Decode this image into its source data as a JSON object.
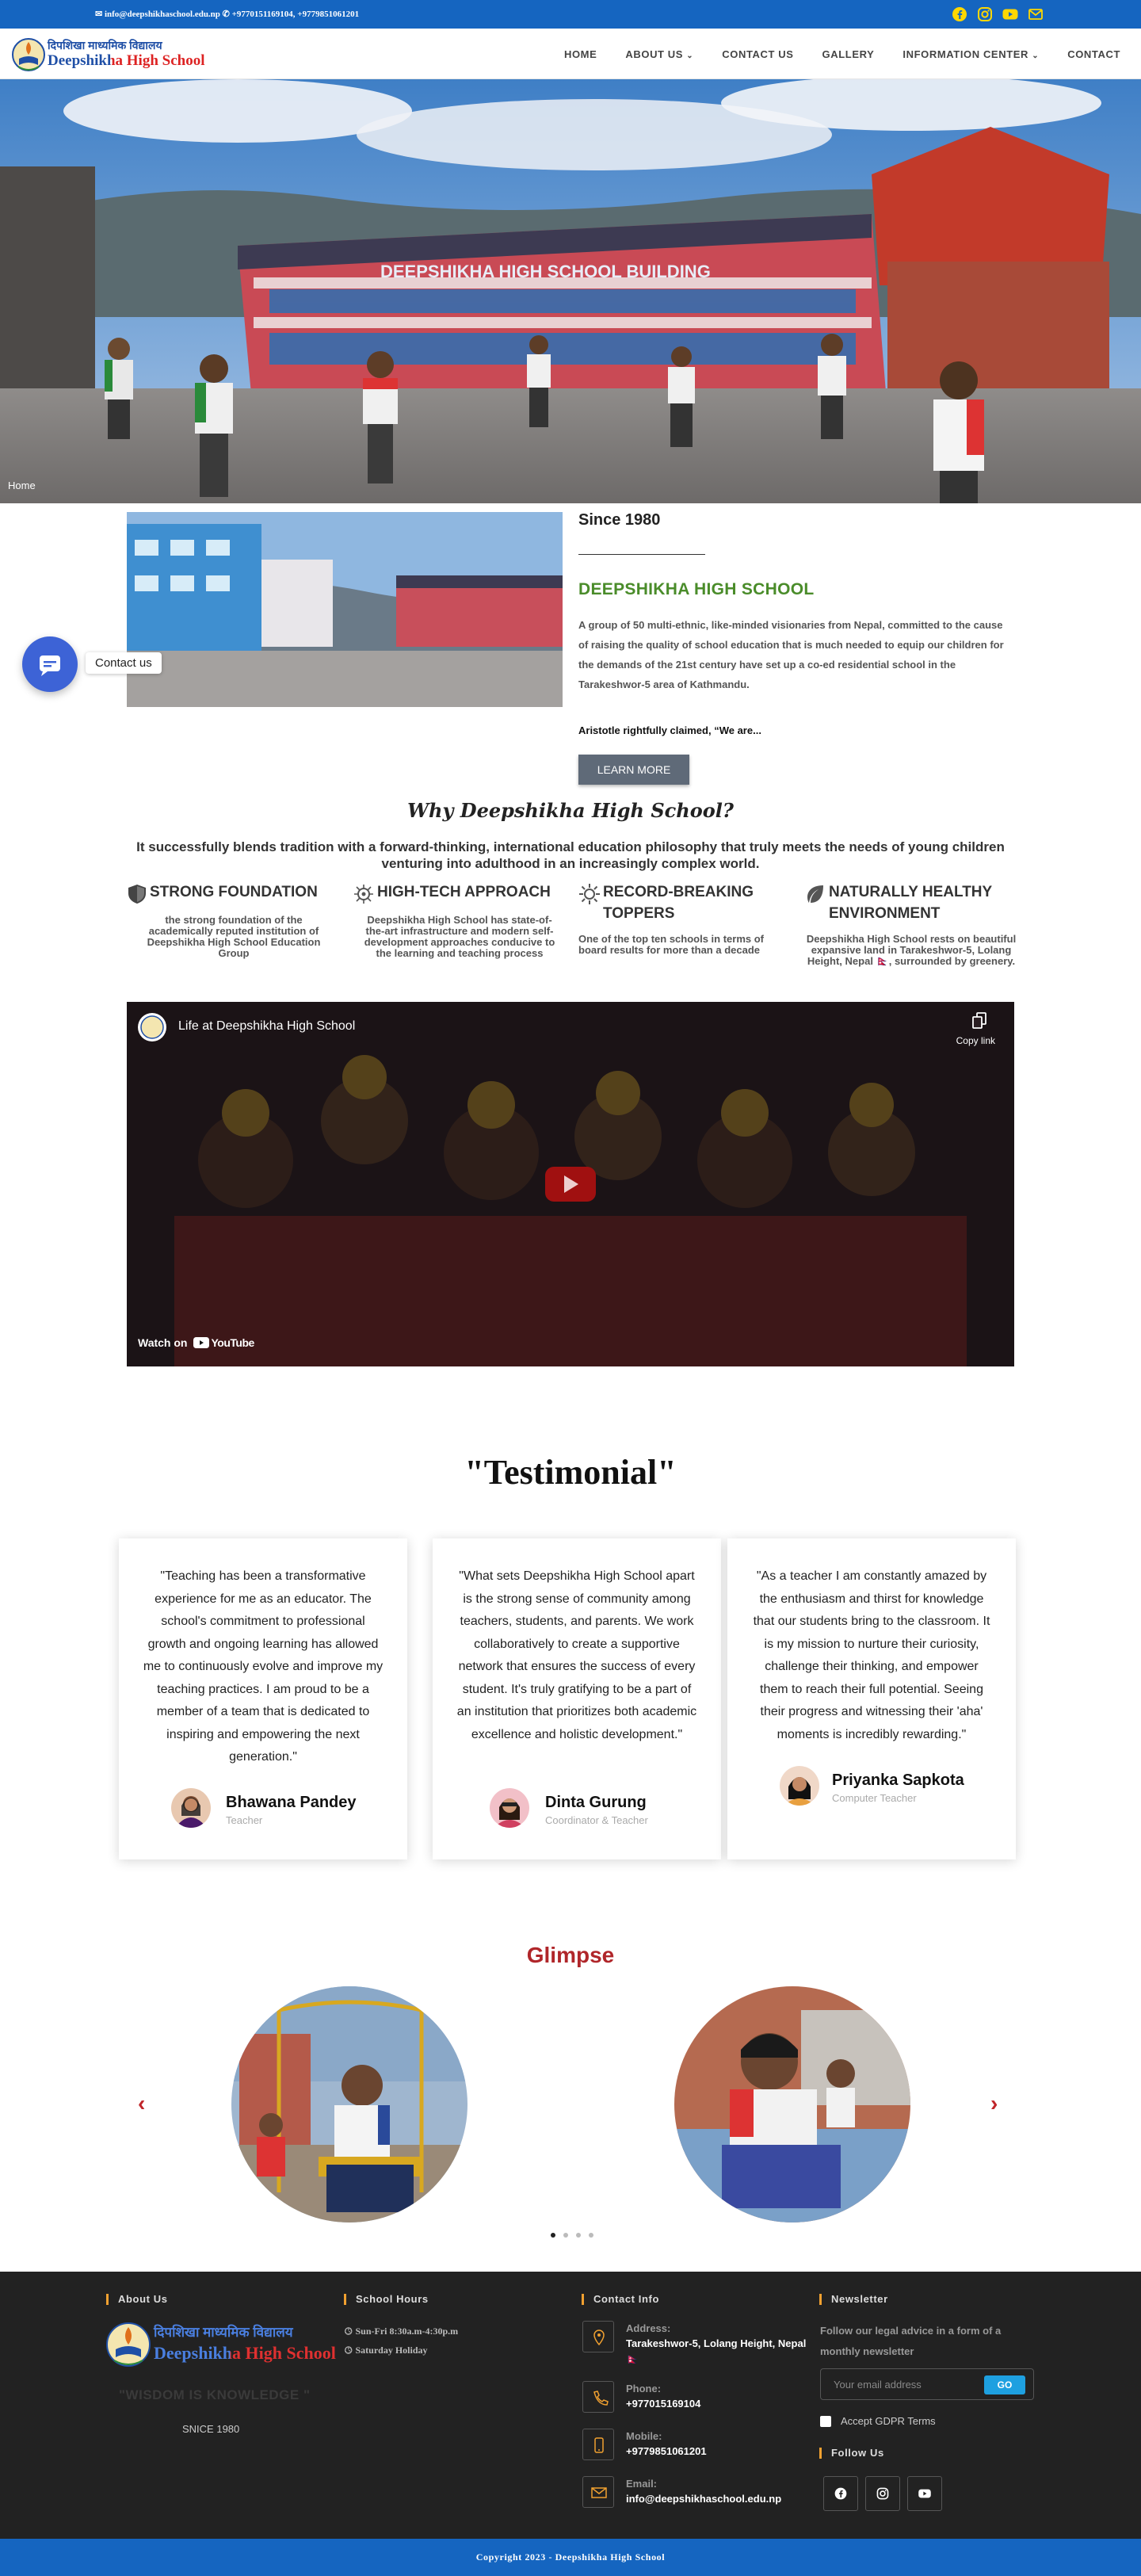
{
  "topbar": {
    "email": "info@deepshikhaschool.edu.np",
    "phones": "+9770151169104, +9779851061201",
    "social_icons": [
      "facebook-icon",
      "instagram-icon",
      "youtube-icon",
      "mail-icon"
    ],
    "icon_color": "#ffd700",
    "bg_color": "#1565c0"
  },
  "header": {
    "logo": {
      "nepali": "दिपशिखा माध्यमिक विद्यालय",
      "english": "Deepshikha High School"
    },
    "nav": [
      {
        "label": "HOME"
      },
      {
        "label": "ABOUT US",
        "dropdown": true
      },
      {
        "label": "CONTACT US"
      },
      {
        "label": "GALLERY"
      },
      {
        "label": "INFORMATION CENTER",
        "dropdown": true
      },
      {
        "label": "CONTACT"
      }
    ]
  },
  "hero": {
    "breadcrumb": "Home",
    "building_sign": "DEEPSHIKHA HIGH SCHOOL BUILDING"
  },
  "about": {
    "since": "Since 1980",
    "title": "DEEPSHIKHA HIGH SCHOOL",
    "description": "A group of 50 multi-ethnic, like-minded visionaries from Nepal, committed to the cause of raising the quality of school education that is much needed to equip our children for the demands of the 21st century have set up a co-ed residential school in the Tarakeshwor-5 area of Kathmandu.",
    "quote": "Aristotle rightfully claimed, “We are...",
    "button": "LEARN MORE",
    "title_color": "#4a8c2a"
  },
  "chat": {
    "label": "Contact us"
  },
  "why": {
    "title": "Why Deepshikha High School?",
    "subtitle": "It successfully blends tradition with a forward-thinking, international education philosophy that truly meets the needs of young children venturing into adulthood in an increasingly complex world.",
    "features": [
      {
        "icon": "shield-icon",
        "title": "STRONG FOUNDATION",
        "desc": "the strong foundation of the academically reputed institution of Deepshikha High School Education Group",
        "align": "center"
      },
      {
        "icon": "circuit-icon",
        "title": "HIGH-TECH APPROACH",
        "desc": "Deepshikha High School has state-of-the-art infrastructure and modern self-development approaches conducive to the learning and teaching process",
        "align": "center"
      },
      {
        "icon": "sun-icon",
        "title": "RECORD-BREAKING TOPPERS",
        "desc": "One of the top ten schools in terms of board results for more than a decade",
        "align": "left"
      },
      {
        "icon": "leaf-icon",
        "title": "NATURALLY HEALTHY ENVIRONMENT",
        "desc": "Deepshikha High School rests on beautiful expansive land in Tarakeshwor-5, Lolang Height, Nepal 🇳🇵, surrounded by greenery.",
        "align": "center"
      }
    ]
  },
  "video": {
    "title": "Life at Deepshikha High School",
    "copy_link": "Copy link",
    "watch_on": "Watch on",
    "youtube": "YouTube"
  },
  "testimonials": {
    "title": "\"Testimonial\"",
    "items": [
      {
        "quote": "\"Teaching has been a transformative experience for me as an educator. The school's commitment to professional growth and ongoing learning has allowed me to continuously evolve and improve my teaching practices. I am proud to be a member of a team that is dedicated to inspiring and empowering the next generation.\"",
        "name": "Bhawana Pandey",
        "role": "Teacher"
      },
      {
        "quote": "\"What sets Deepshikha High School apart is the strong sense of community among teachers, students, and parents. We work collaboratively to create a supportive network that ensures the success of every student. It's truly gratifying to be a part of an institution that prioritizes both academic excellence and holistic development.\"",
        "name": "Dinta Gurung",
        "role": "Coordinator & Teacher"
      },
      {
        "quote": "\"As a teacher I am constantly amazed by the enthusiasm and thirst for knowledge that our students bring to the classroom. It is my mission to nurture their curiosity, challenge their thinking, and empower them to reach their full potential. Seeing their progress and witnessing their 'aha' moments is incredibly rewarding.\"",
        "name": "Priyanka Sapkota",
        "role": "Computer Teacher"
      }
    ]
  },
  "glimpse": {
    "title": "Glimpse",
    "prev": "‹",
    "next": "›",
    "slides": 4,
    "active_slide": 1,
    "accent": "#b0262a"
  },
  "footer": {
    "about": {
      "heading": "About Us",
      "motto": "\"WISDOM IS KNOWLEDGE \"",
      "since": "SNICE 1980"
    },
    "hours": {
      "heading": "School Hours",
      "line1": "Sun-Fri 8:30a.m-4:30p.m",
      "line2": "Saturday Holiday"
    },
    "contact": {
      "heading": "Contact Info",
      "address_label": "Address:",
      "address": "Tarakeshwor-5, Lolang Height, Nepal 🇳🇵",
      "phone_label": "Phone:",
      "phone": "+977015169104",
      "mobile_label": "Mobile:",
      "mobile": "+9779851061201",
      "email_label": "Email:",
      "email": "info@deepshikhaschool.edu.np"
    },
    "newsletter": {
      "heading": "Newsletter",
      "text": "Follow our legal advice in a form of a monthly newsletter",
      "placeholder": "Your email address",
      "button": "GO",
      "gdpr": "Accept GDPR Terms",
      "follow": "Follow Us"
    },
    "copyright": "Copyright 2023 - Deepshikha High School"
  }
}
